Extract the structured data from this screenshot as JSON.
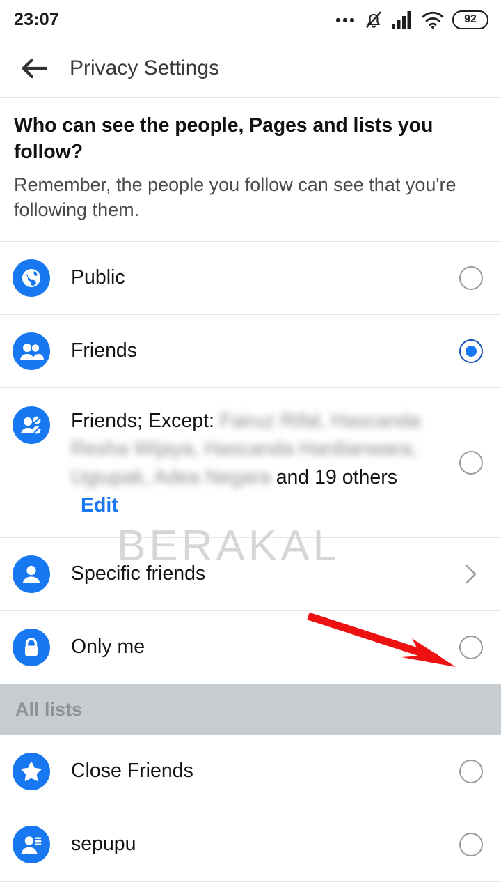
{
  "statusbar": {
    "clock": "23:07",
    "battery_level": "92",
    "icons": [
      "more-dots-icon",
      "bell-muted-icon",
      "signal-bars-icon",
      "wifi-icon",
      "battery-icon"
    ]
  },
  "appbar": {
    "back_icon": "back-arrow-icon",
    "title": "Privacy Settings"
  },
  "question": {
    "title": "Who can see the people, Pages and lists you follow?",
    "subtitle": "Remember, the people you follow can see that you're following them."
  },
  "options": [
    {
      "label": "Public",
      "icon": "globe-icon",
      "control": "radio",
      "selected": false
    },
    {
      "label": "Friends",
      "icon": "friends-icon",
      "control": "radio",
      "selected": true
    },
    {
      "label_prefix": "Friends; Except:",
      "blurred_names": "Fairuz Rifal, Hascanda Resha Wijaya, Hascanda Hardianwara, Ugiupak, Adea Negara",
      "label_suffix": "and 19 others",
      "edit_label": "Edit",
      "icon": "friends-except-icon",
      "control": "radio",
      "selected": false
    },
    {
      "label": "Specific friends",
      "icon": "person-icon",
      "control": "chevron",
      "selected": false
    },
    {
      "label": "Only me",
      "icon": "lock-icon",
      "control": "radio",
      "selected": false
    }
  ],
  "section": {
    "all_lists_label": "All lists"
  },
  "lists": [
    {
      "label": "Close Friends",
      "icon": "star-icon",
      "control": "radio",
      "selected": false
    },
    {
      "label": "sepupu",
      "icon": "person-list-icon",
      "control": "radio",
      "selected": false
    }
  ],
  "watermark": {
    "text": "BERAKAL"
  },
  "annotation": {
    "arrow_color": "#ee1111",
    "arrow_target": "only-me-radio"
  },
  "colors": {
    "accent_blue": "#1778f2",
    "selected_ring": "#1a4fb4",
    "section_bg": "#c7ccd1",
    "arrow_red": "#ee1111"
  }
}
